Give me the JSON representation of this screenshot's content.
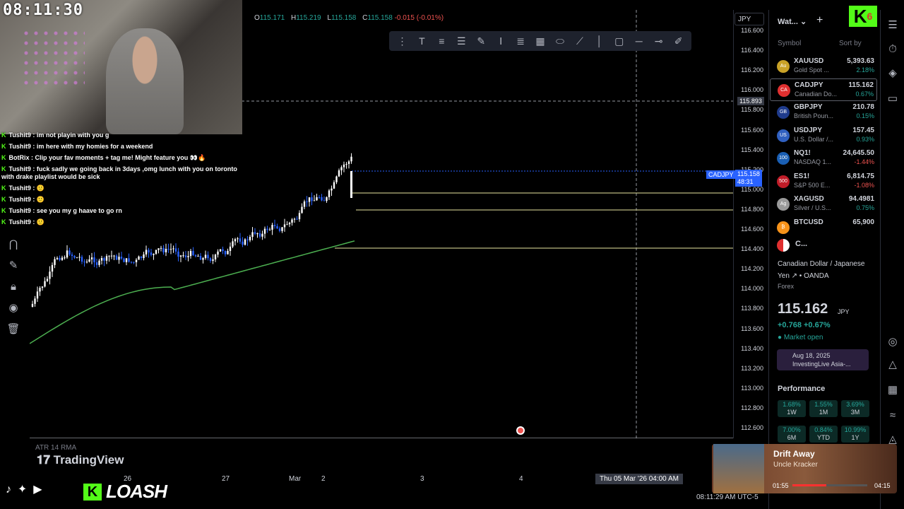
{
  "clock": "08:11:30",
  "chart": {
    "ohlc": {
      "o_label": "O",
      "o": "115.171",
      "h_label": "H",
      "h": "115.219",
      "l_label": "L",
      "l": "115.158",
      "c_label": "C",
      "c": "115.158",
      "change": "-0.015 (-0.01%)"
    },
    "currency": "JPY",
    "price_ticks": [
      "116.600",
      "116.400",
      "116.200",
      "116.000",
      "115.800",
      "115.600",
      "115.400",
      "115.200",
      "115.000",
      "114.800",
      "114.600",
      "114.400",
      "114.200",
      "114.000",
      "113.800",
      "113.600",
      "113.400",
      "113.200",
      "113.000",
      "112.800",
      "112.600"
    ],
    "crosshair_price": "115.893",
    "symbol_tag": "CADJPY",
    "last_price_tag": "115.158",
    "countdown": "48:31",
    "time_labels": [
      "26",
      "27",
      "Mar",
      "2",
      "3",
      "4"
    ],
    "crosshair_time": "Thu 05 Mar '26   04:00 AM",
    "indicator_label": "ATR 14 RMA",
    "brand": "TradingView",
    "ma_color": "#4caf50",
    "up_color": "#ffffff",
    "down_color": "#2962ff"
  },
  "chat": [
    {
      "user": "Tushit9",
      "msg": "im not playin with you g"
    },
    {
      "user": "Tushit9",
      "msg": "im here with my homies for a weekend"
    },
    {
      "user": "BotRix",
      "msg": "Clip your fav moments + tag me! Might feature you 👀🔥"
    },
    {
      "user": "Tushit9",
      "msg": "fuck sadly we going back in 3days ,omg lunch with you on toronto with drake playlist would be sick"
    },
    {
      "user": "Tushit9",
      "msg": "🙂"
    },
    {
      "user": "Tushit9",
      "msg": "🙂"
    },
    {
      "user": "Tushit9",
      "msg": "see you my g haave to go rn"
    },
    {
      "user": "Tushit9",
      "msg": "🙂"
    }
  ],
  "watchlist": {
    "title": "Wat...",
    "col_symbol": "Symbol",
    "col_sort": "Sort by",
    "rows": [
      {
        "sym": "XAUUSD",
        "desc": "Gold Spot ...",
        "last": "5,393.63",
        "chg": "2.18%",
        "dir": "pos",
        "icon": "#c9a227",
        "icon_text": "Au"
      },
      {
        "sym": "CADJPY",
        "desc": "Canadian Do...",
        "last": "115.162",
        "chg": "0.67%",
        "dir": "pos",
        "icon": "#e03030",
        "icon_text": "CA"
      },
      {
        "sym": "GBPJPY",
        "desc": "British Poun...",
        "last": "210.78",
        "chg": "0.15%",
        "dir": "pos",
        "icon": "#1f3b8c",
        "icon_text": "GB"
      },
      {
        "sym": "USDJPY",
        "desc": "U.S. Dollar /...",
        "last": "157.45",
        "chg": "0.93%",
        "dir": "pos",
        "icon": "#3060c0",
        "icon_text": "US"
      },
      {
        "sym": "NQ1!",
        "desc": "NASDAQ 1...",
        "last": "24,645.50",
        "chg": "-1.44%",
        "dir": "neg",
        "icon": "#1a5fb4",
        "icon_text": "100"
      },
      {
        "sym": "ES1!",
        "desc": "S&P 500 E...",
        "last": "6,814.75",
        "chg": "-1.08%",
        "dir": "neg",
        "icon": "#c01c28",
        "icon_text": "500"
      },
      {
        "sym": "XAGUSD",
        "desc": "Silver / U.S...",
        "last": "94.4981",
        "chg": "0.75%",
        "dir": "pos",
        "icon": "#9a9a9a",
        "icon_text": "Ag"
      },
      {
        "sym": "BTCUSD",
        "desc": "",
        "last": "65,900",
        "chg": "",
        "dir": "pos",
        "icon": "#f7931a",
        "icon_text": "₿"
      }
    ]
  },
  "detail": {
    "sym": "C...",
    "name": "Canadian Dollar / Japanese Yen ↗ • OANDA",
    "type": "Forex",
    "price": "115.162",
    "currency": "JPY",
    "change": "+0.768  +0.67%",
    "status": "Market open",
    "news_date": "Aug 18, 2025",
    "news_source": "InvestingLive Asia-...",
    "perf_title": "Performance",
    "perf": [
      {
        "v": "1.68%",
        "l": "1W"
      },
      {
        "v": "1.55%",
        "l": "1M"
      },
      {
        "v": "3.69%",
        "l": "3M"
      },
      {
        "v": "7.00%",
        "l": "6M"
      },
      {
        "v": "0.84%",
        "l": "YTD"
      },
      {
        "v": "10.99%",
        "l": "1Y"
      }
    ]
  },
  "music": {
    "title": "Drift Away",
    "artist": "Uncle Kracker",
    "current": "01:55",
    "total": "04:15",
    "progress": 0.45
  },
  "branding": {
    "name": "LOASH",
    "k": "K",
    "k_badge": "6"
  },
  "bottom_clock": "08:11:29 AM UTC-5"
}
